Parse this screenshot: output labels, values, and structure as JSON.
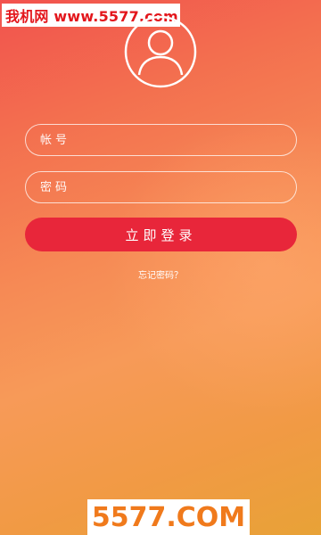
{
  "watermark": {
    "top_text": "我机网 www.5577.com",
    "bottom_text": "5577.COM"
  },
  "avatar": {
    "icon": "user-avatar-icon"
  },
  "login_form": {
    "account_placeholder": "帐号",
    "password_placeholder": "密码",
    "login_button_label": "立即登录",
    "forgot_password_link": "忘记密码？"
  },
  "colors": {
    "button_red": "#e8263a",
    "background_top": "#f2524e",
    "background_bottom": "#e8a237",
    "watermark_red": "#e3161c",
    "watermark_orange": "#f07a1c"
  }
}
